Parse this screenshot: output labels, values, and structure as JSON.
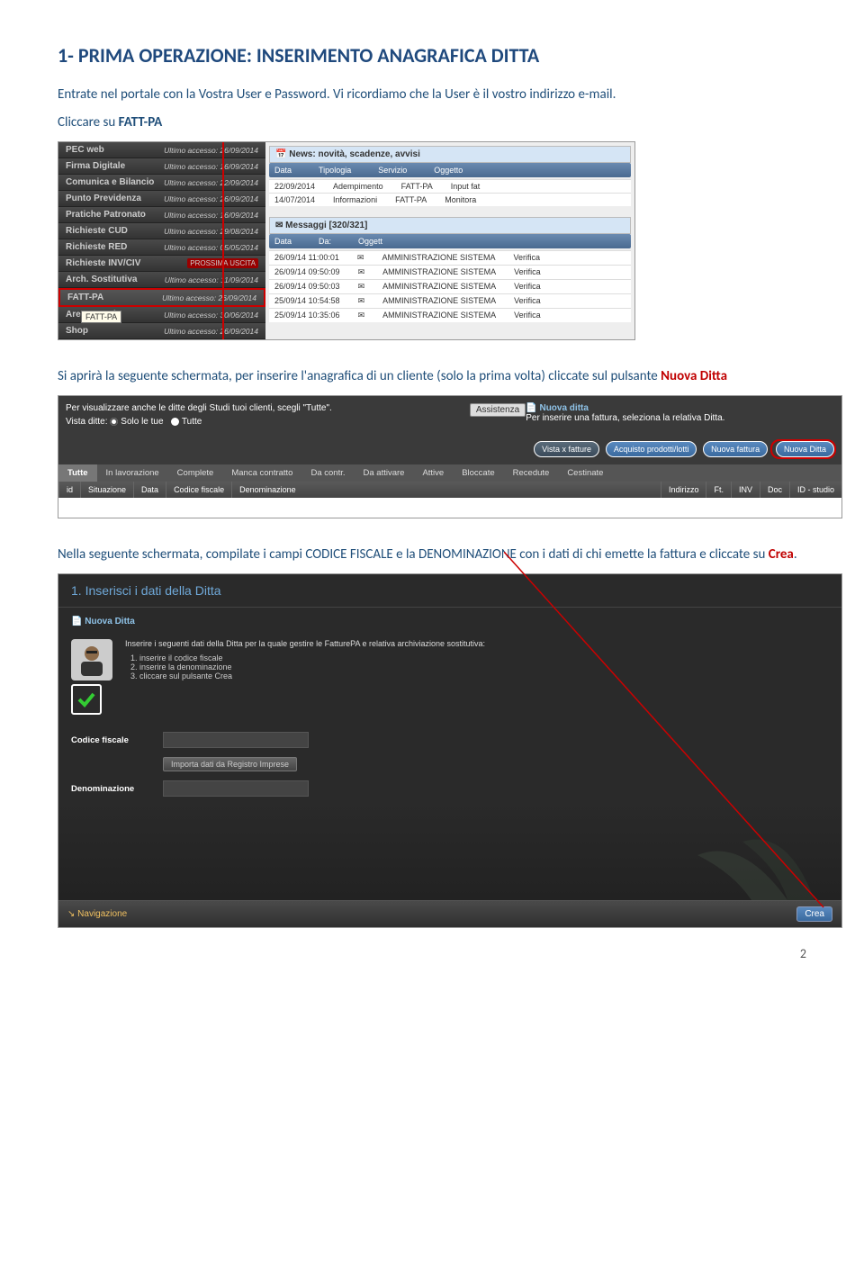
{
  "heading": "1- PRIMA OPERAZIONE: INSERIMENTO ANAGRAFICA DITTA",
  "intro1": "Entrate nel portale con la Vostra User e Password. Vi ricordiamo che la User è il vostro indirizzo e-mail.",
  "intro2_a": "Cliccare su ",
  "intro2_b": "FATT-PA",
  "sc1": {
    "menu": [
      {
        "label": "PEC web",
        "access": "Ultimo accesso: 26/09/2014"
      },
      {
        "label": "Firma Digitale",
        "access": "Ultimo accesso: 16/09/2014"
      },
      {
        "label": "Comunica e Bilancio",
        "access": "Ultimo accesso: 22/09/2014"
      },
      {
        "label": "Punto Previdenza",
        "access": "Ultimo accesso: 26/09/2014"
      },
      {
        "label": "Pratiche Patronato",
        "access": "Ultimo accesso: 16/09/2014"
      },
      {
        "label": "Richieste CUD",
        "access": "Ultimo accesso: 29/08/2014"
      },
      {
        "label": "Richieste RED",
        "access": "Ultimo accesso: 05/05/2014"
      },
      {
        "label": "Richieste INV/CIV",
        "access": "PROSSIMA USCITA"
      },
      {
        "label": "Arch. Sostitutiva",
        "access": "Ultimo accesso: 11/09/2014"
      },
      {
        "label": "FATT-PA",
        "access": "Ultimo accesso: 26/09/2014"
      },
      {
        "label": "Area Agenti",
        "access": "Ultimo accesso: 30/06/2014"
      },
      {
        "label": "Shop",
        "access": "Ultimo accesso: 26/09/2014"
      }
    ],
    "tooltip": "FATT-PA",
    "news_title": "News: novità, scadenze, avvisi",
    "news_cols": [
      "Data",
      "Tipologia",
      "Servizio",
      "Oggetto"
    ],
    "news_rows": [
      [
        "22/09/2014",
        "Adempimento",
        "FATT-PA",
        "Input fat"
      ],
      [
        "14/07/2014",
        "Informazioni",
        "FATT-PA",
        "Monitora"
      ]
    ],
    "msg_title": "Messaggi [320/321]",
    "msg_cols": [
      "Data",
      "Da:",
      "Oggett"
    ],
    "msg_rows": [
      [
        "26/09/14 11:00:01",
        "AMMINISTRAZIONE SISTEMA",
        "Verifica"
      ],
      [
        "26/09/14 09:50:09",
        "AMMINISTRAZIONE SISTEMA",
        "Verifica"
      ],
      [
        "26/09/14 09:50:03",
        "AMMINISTRAZIONE SISTEMA",
        "Verifica"
      ],
      [
        "25/09/14 10:54:58",
        "AMMINISTRAZIONE SISTEMA",
        "Verifica"
      ],
      [
        "25/09/14 10:35:06",
        "AMMINISTRAZIONE SISTEMA",
        "Verifica"
      ]
    ]
  },
  "mid1a": "Si aprirà la seguente schermata, per inserire l'anagrafica di un cliente (solo la prima volta) cliccate sul pulsante ",
  "mid1b": "Nuova Ditta",
  "sc2": {
    "help_line": "Per visualizzare anche le ditte degli Studi tuoi clienti, scegli \"Tutte\".",
    "vista_label": "Vista ditte:",
    "radio1": "Solo le tue",
    "radio2": "Tutte",
    "assist": "Assistenza",
    "nd_title": "Nuova ditta",
    "nd_sub": "Per inserire una fattura, seleziona la relativa Ditta.",
    "pills": [
      "Vista x fatture",
      "Acquisto prodotti/lotti",
      "Nuova fattura",
      "Nuova Ditta"
    ],
    "tabs": [
      "Tutte",
      "In lavorazione",
      "Complete",
      "Manca contratto",
      "Da contr.",
      "Da attivare",
      "Attive",
      "Bloccate",
      "Recedute",
      "Cestinate"
    ],
    "cols": [
      "id ",
      "Situazione",
      "Data",
      "Codice fiscale",
      "Denominazione",
      "Indirizzo",
      "Ft.",
      "INV",
      "Doc",
      "ID - studio"
    ]
  },
  "mid2a": "Nella seguente schermata, compilate i campi CODICE FISCALE e la DENOMINAZIONE con i dati di chi emette la fattura e cliccate su ",
  "mid2b": "Crea",
  "mid2c": ".",
  "sc3": {
    "title": "1. Inserisci i dati della Ditta",
    "box_title": "Nuova Ditta",
    "lead": "Inserire i seguenti dati della Ditta per la quale gestire le FatturePA e relativa archiviazione sostitutiva:",
    "steps": [
      "inserire il codice fiscale",
      "inserire la denominazione",
      "cliccare sul pulsante Crea"
    ],
    "f1": "Codice fiscale",
    "import": "Importa dati da Registro Imprese",
    "f2": "Denominazione",
    "nav": "Navigazione",
    "crea": "Crea"
  },
  "page": "2"
}
